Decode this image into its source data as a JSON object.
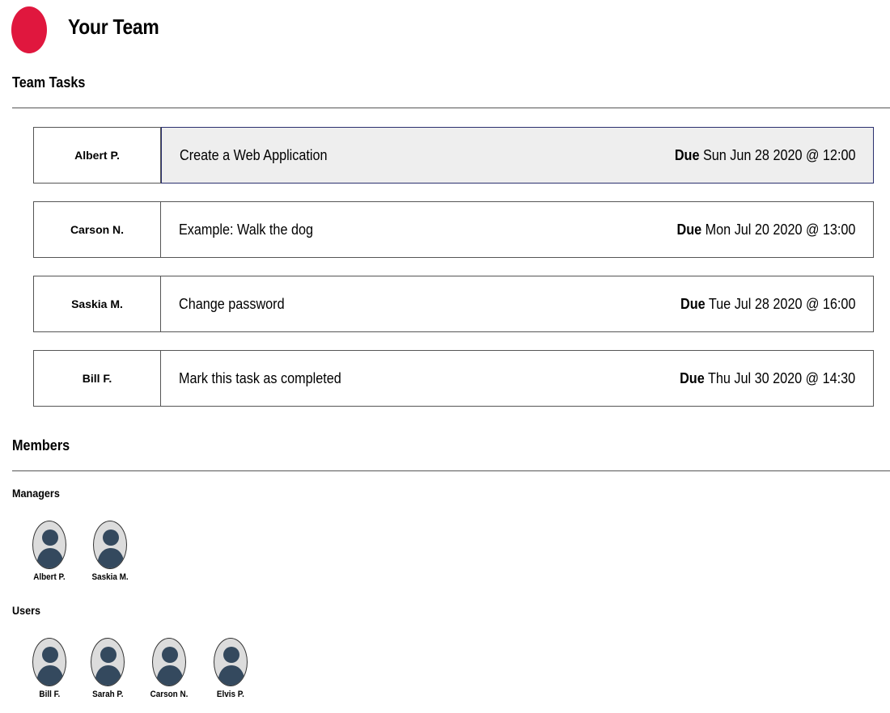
{
  "header": {
    "title": "Your Team"
  },
  "tasks_section": {
    "title": "Team Tasks"
  },
  "tasks": [
    {
      "owner": "Albert P.",
      "name": "Create a Web Application",
      "due_label": "Due",
      "due_date": "Sun Jun 28 2020 @ 12:00",
      "selected": true
    },
    {
      "owner": "Carson N.",
      "name": "Example: Walk the dog",
      "due_label": "Due",
      "due_date": "Mon Jul 20 2020 @ 13:00",
      "selected": false
    },
    {
      "owner": "Saskia M.",
      "name": "Change password",
      "due_label": "Due",
      "due_date": "Tue Jul 28 2020 @ 16:00",
      "selected": false
    },
    {
      "owner": "Bill F.",
      "name": "Mark this task as completed",
      "due_label": "Due",
      "due_date": "Thu Jul 30 2020 @ 14:30",
      "selected": false
    }
  ],
  "members_section": {
    "title": "Members",
    "managers_label": "Managers",
    "users_label": "Users",
    "managers": [
      {
        "name": "Albert P."
      },
      {
        "name": "Saskia M."
      }
    ],
    "users": [
      {
        "name": "Bill F."
      },
      {
        "name": "Sarah P."
      },
      {
        "name": "Carson N."
      },
      {
        "name": "Elvis P."
      }
    ]
  },
  "colors": {
    "logo": "#e0173e",
    "avatar_figure": "#34495e",
    "avatar_bg": "#dcdcdc",
    "selected_bg": "#eeeeee",
    "selected_border": "#2a2f6e"
  },
  "icons": {
    "logo": "logo-circle",
    "avatar": "user-silhouette-icon"
  }
}
